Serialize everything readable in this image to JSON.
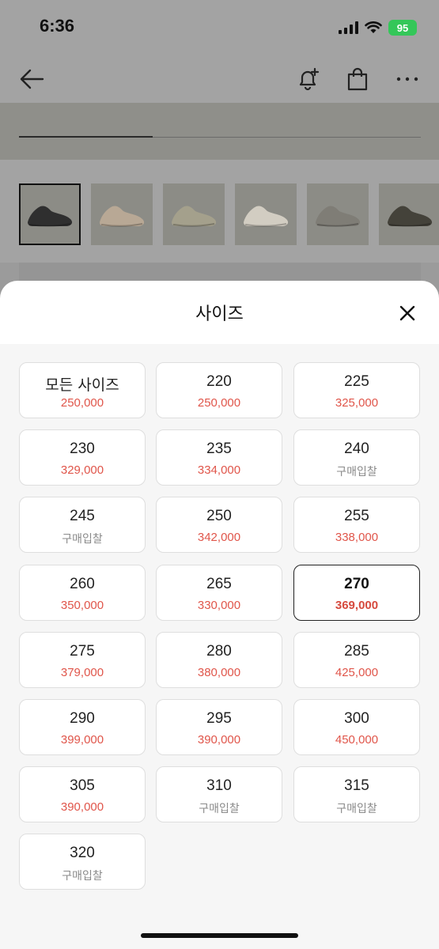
{
  "status_bar": {
    "time": "6:36",
    "battery": "95"
  },
  "sheet": {
    "title": "사이즈"
  },
  "thumbnails": [
    {
      "name": "thumb-black",
      "color": "#2f2f2f"
    },
    {
      "name": "thumb-taupe",
      "color": "#b8a895"
    },
    {
      "name": "thumb-sage",
      "color": "#a4a08c"
    },
    {
      "name": "thumb-cream",
      "color": "#d2cdc2"
    },
    {
      "name": "thumb-stone",
      "color": "#7f7d76"
    },
    {
      "name": "thumb-olive",
      "color": "#44423a"
    }
  ],
  "sizes": [
    {
      "label": "모든 사이즈",
      "price": "250,000",
      "status": "price"
    },
    {
      "label": "220",
      "price": "250,000",
      "status": "price"
    },
    {
      "label": "225",
      "price": "325,000",
      "status": "price"
    },
    {
      "label": "230",
      "price": "329,000",
      "status": "price"
    },
    {
      "label": "235",
      "price": "334,000",
      "status": "price"
    },
    {
      "label": "240",
      "price": "구매입찰",
      "status": "bid"
    },
    {
      "label": "245",
      "price": "구매입찰",
      "status": "bid"
    },
    {
      "label": "250",
      "price": "342,000",
      "status": "price"
    },
    {
      "label": "255",
      "price": "338,000",
      "status": "price"
    },
    {
      "label": "260",
      "price": "350,000",
      "status": "price"
    },
    {
      "label": "265",
      "price": "330,000",
      "status": "price"
    },
    {
      "label": "270",
      "price": "369,000",
      "status": "price",
      "selected": true
    },
    {
      "label": "275",
      "price": "379,000",
      "status": "price"
    },
    {
      "label": "280",
      "price": "380,000",
      "status": "price"
    },
    {
      "label": "285",
      "price": "425,000",
      "status": "price"
    },
    {
      "label": "290",
      "price": "399,000",
      "status": "price"
    },
    {
      "label": "295",
      "price": "390,000",
      "status": "price"
    },
    {
      "label": "300",
      "price": "450,000",
      "status": "price"
    },
    {
      "label": "305",
      "price": "390,000",
      "status": "price"
    },
    {
      "label": "310",
      "price": "구매입찰",
      "status": "bid"
    },
    {
      "label": "315",
      "price": "구매입찰",
      "status": "bid"
    },
    {
      "label": "320",
      "price": "구매입찰",
      "status": "bid"
    }
  ],
  "colors": {
    "price": "#e0554a",
    "bid": "#8a8a8a",
    "battery": "#34c759"
  }
}
